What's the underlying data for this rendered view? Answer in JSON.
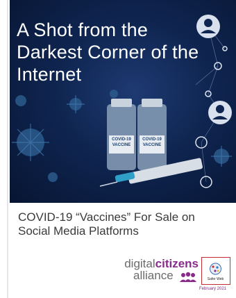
{
  "cover": {
    "title": "A Shot from the Darkest Corner of the Internet",
    "subtitle": "COVID-19 “Vaccines” For Sale on Social Media Platforms",
    "vial_label_line1": "COVID-19",
    "vial_label_line2": "VACCINE",
    "vial_label_line3": "COVID-19",
    "vial_label_line4": "VACCINE",
    "date": "February 2021"
  },
  "logo": {
    "part1": "digital",
    "part2": "citizens",
    "part3": "alliance",
    "badge_label": "Safer Web"
  },
  "colors": {
    "hero_bg": "#0f2550",
    "virus": "#2b5b8c",
    "accent_purple": "#8a2a8a",
    "badge_border": "#c72b33"
  }
}
